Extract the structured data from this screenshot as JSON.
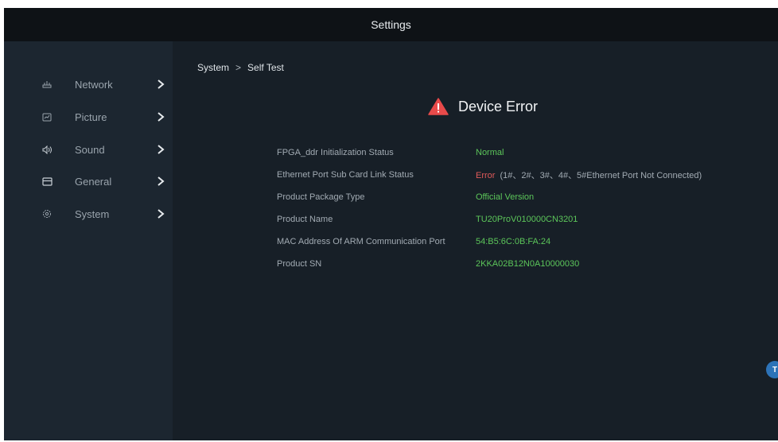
{
  "app": {
    "title": "Settings"
  },
  "sidebar": {
    "items": [
      {
        "label": "Network",
        "icon": "network-icon"
      },
      {
        "label": "Picture",
        "icon": "picture-icon"
      },
      {
        "label": "Sound",
        "icon": "sound-icon"
      },
      {
        "label": "General",
        "icon": "general-icon"
      },
      {
        "label": "System",
        "icon": "system-icon"
      }
    ]
  },
  "breadcrumb": {
    "parent": "System",
    "separator": ">",
    "current": "Self Test"
  },
  "status": {
    "title": "Device Error",
    "icon": "warning-icon"
  },
  "rows": [
    {
      "key": "FPGA_ddr Initialization Status",
      "value": "Normal"
    },
    {
      "key": "Ethernet Port Sub Card Link Status",
      "value": "Error",
      "detail": "(1#、2#、3#、4#、5#Ethernet Port Not Connected)"
    },
    {
      "key": "Product Package Type",
      "value": "Official Version"
    },
    {
      "key": "Product Name",
      "value": "TU20ProV010000CN3201"
    },
    {
      "key": "MAC Address Of ARM Communication Port",
      "value": "54:B5:6C:0B:FA:24"
    },
    {
      "key": "Product SN",
      "value": "2KKA02B12N0A10000030"
    }
  ],
  "colors": {
    "background": "#171f27",
    "sidebar": "#1c2630",
    "titlebar": "#0e1216",
    "ok": "#5cc65a",
    "error": "#e05a5a",
    "warning": "#e84a4a",
    "accent": "#2d73b8"
  },
  "floating_button": {
    "label": "T"
  }
}
